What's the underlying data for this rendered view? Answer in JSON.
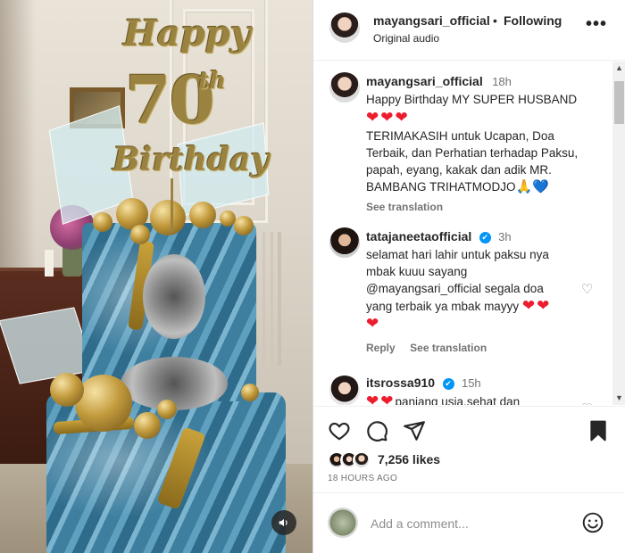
{
  "media": {
    "topper": {
      "happy": "Happy",
      "number": "70",
      "suffix": "th",
      "birthday": "Birthday"
    }
  },
  "header": {
    "username": "mayangsari_official",
    "separator": "•",
    "follow_status": "Following",
    "audio": "Original audio",
    "more": "•••"
  },
  "comments": [
    {
      "username": "mayangsari_official",
      "time": "18h",
      "lines": [
        "Happy Birthday MY SUPER HUSBAND",
        "TERIMAKASIH untuk Ucapan, Doa",
        "Terbaik, dan Perhatian terhadap Paksu,",
        "papah, eyang, kakak dan adik MR.",
        "BAMBANG TRIHATMODJO"
      ],
      "hearts": "❤❤❤",
      "trail": "🙏💙",
      "see_translation": "See translation"
    },
    {
      "username": "tatajaneetaofficial",
      "verified": "✔",
      "time": "3h",
      "lines": [
        "selamat hari lahir untuk paksu nya",
        "mbak kuuu sayang",
        "@mayangsari_official segala doa",
        "yang terbaik ya mbak mayyy"
      ],
      "hearts": "❤❤",
      "trail_heart": "❤",
      "reply": "Reply",
      "see_translation": "See translation"
    },
    {
      "username": "itsrossa910",
      "verified": "✔",
      "time": "15h",
      "hearts": "❤❤",
      "text": "panjang usia,sehat dan"
    }
  ],
  "actions": {
    "likes": "7,256 likes",
    "time": "18 HOURS AGO"
  },
  "add_comment": {
    "placeholder": "Add a comment..."
  },
  "colors": {
    "heart": "#ed1c2e",
    "verified": "#0095f6",
    "text": "#262626",
    "muted": "#737373"
  }
}
